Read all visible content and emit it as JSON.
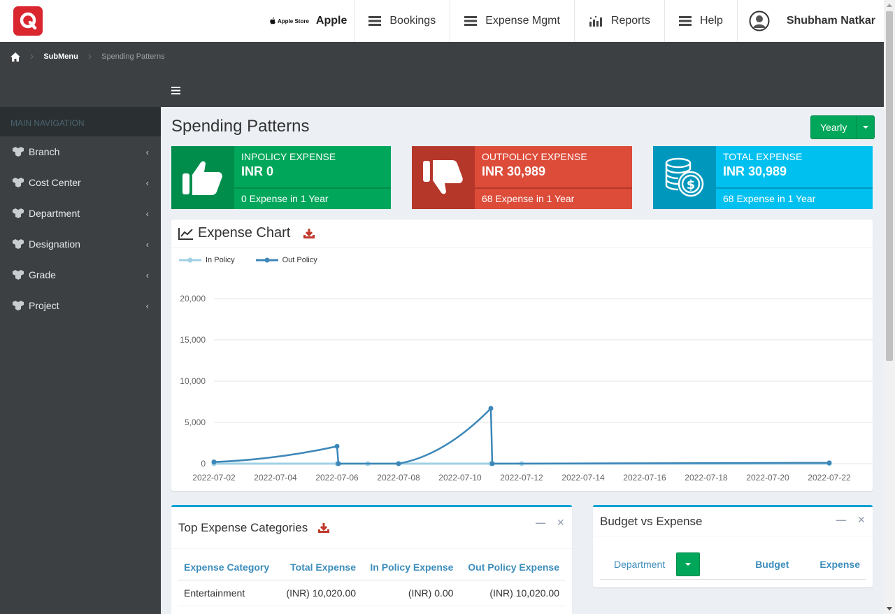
{
  "header": {
    "brand_store": "Apple Store",
    "brand_name": "Apple",
    "nav": [
      "Bookings",
      "Expense Mgmt",
      "Reports",
      "Help"
    ],
    "user_name": "Shubham Natkar"
  },
  "breadcrumb": {
    "submenu": "SubMenu",
    "current": "Spending Patterns"
  },
  "sidebar": {
    "heading": "MAIN NAVIGATION",
    "items": [
      {
        "label": "Branch"
      },
      {
        "label": "Cost Center"
      },
      {
        "label": "Department"
      },
      {
        "label": "Designation"
      },
      {
        "label": "Grade"
      },
      {
        "label": "Project"
      }
    ]
  },
  "page": {
    "title": "Spending Patterns",
    "period": "Yearly"
  },
  "cards": [
    {
      "title": "INPOLICY EXPENSE",
      "value": "INR 0",
      "desc": "0 Expense in 1 Year"
    },
    {
      "title": "OUTPOLICY EXPENSE",
      "value": "INR 30,989",
      "desc": "68 Expense in 1 Year"
    },
    {
      "title": "TOTAL EXPENSE",
      "value": "INR 30,989",
      "desc": "68 Expense in 1 Year"
    }
  ],
  "expense_chart": {
    "title": "Expense Chart"
  },
  "chart_data": {
    "type": "line",
    "title": "Expense Chart",
    "xlabel": "",
    "ylabel": "",
    "ylim": [
      0,
      20000
    ],
    "yticks": [
      "0",
      "5,000",
      "10,000",
      "15,000",
      "20,000"
    ],
    "xticks": [
      "2022-07-02",
      "2022-07-04",
      "2022-07-06",
      "2022-07-08",
      "2022-07-10",
      "2022-07-12",
      "2022-07-14",
      "2022-07-16",
      "2022-07-18",
      "2022-07-20",
      "2022-07-22"
    ],
    "legend_position": "top-left",
    "series": [
      {
        "name": "In Policy",
        "color": "#9fd0e3",
        "points": [
          [
            "2022-07-02",
            0
          ],
          [
            "2022-07-06",
            0
          ],
          [
            "2022-07-06",
            0
          ],
          [
            "2022-07-07",
            0
          ],
          [
            "2022-07-08",
            0
          ],
          [
            "2022-07-11",
            0
          ],
          [
            "2022-07-12",
            0
          ],
          [
            "2022-07-22",
            0
          ]
        ]
      },
      {
        "name": "Out Policy",
        "color": "#3c87b8",
        "points": [
          [
            "2022-07-02",
            200
          ],
          [
            "2022-07-06",
            2100
          ],
          [
            "2022-07-06",
            0
          ],
          [
            "2022-07-08",
            0
          ],
          [
            "2022-07-11",
            6700
          ],
          [
            "2022-07-11",
            0
          ],
          [
            "2022-07-22",
            100
          ]
        ]
      }
    ]
  },
  "top_categories": {
    "title": "Top Expense Categories",
    "columns": [
      "Expense Category",
      "Total Expense",
      "In Policy Expense",
      "Out Policy Expense"
    ],
    "rows": [
      [
        "Entertainment",
        "(INR) 10,020.00",
        "(INR) 0.00",
        "(INR) 10,020.00"
      ]
    ]
  },
  "budget_vs_expense": {
    "title": "Budget vs Expense",
    "dropdown_label": "Department",
    "col_budget": "Budget",
    "col_expense": "Expense"
  },
  "colors": {
    "green": "#00a65a",
    "red": "#dd4b39",
    "aqua": "#00c0ef",
    "sidebar": "#3c4043",
    "link": "#3c8dbc"
  }
}
